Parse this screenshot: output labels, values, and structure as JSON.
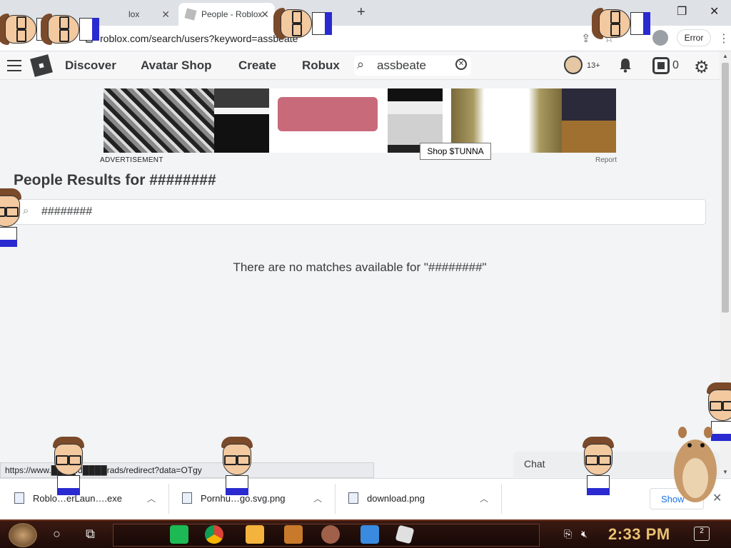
{
  "browser": {
    "tabs": [
      {
        "title": "lox",
        "active": false
      },
      {
        "title": "People - Roblox",
        "active": true
      }
    ],
    "url": "roblox.com/search/users?keyword=assbeate",
    "error_label": "Error"
  },
  "roblox_nav": {
    "links": [
      "Discover",
      "Avatar Shop",
      "Create",
      "Robux"
    ],
    "search_value": "assbeate",
    "age_badge": "13+",
    "robux_count": "0"
  },
  "ad": {
    "label": "ADVERTISEMENT",
    "report": "Report",
    "tooltip": "Shop $TUNNA"
  },
  "page": {
    "title": "People Results for ########",
    "search_value": "########",
    "no_match": "There are no matches available for \"########\""
  },
  "status_url": "https://www.████.d████rads/redirect?data=OTgy",
  "chat_label": "Chat",
  "downloads": [
    {
      "name": "Roblo…erLaun….exe"
    },
    {
      "name": "Pornhu…go.svg.png"
    },
    {
      "name": "download.png"
    }
  ],
  "show_all": "Show",
  "taskbar": {
    "time": "2:33 PM",
    "notif_count": "2"
  },
  "colors": {
    "page_bg": "#f2f4f5",
    "nav_text": "#393b3d",
    "taskbar": "#2a120c",
    "clock": "#e8c070"
  }
}
